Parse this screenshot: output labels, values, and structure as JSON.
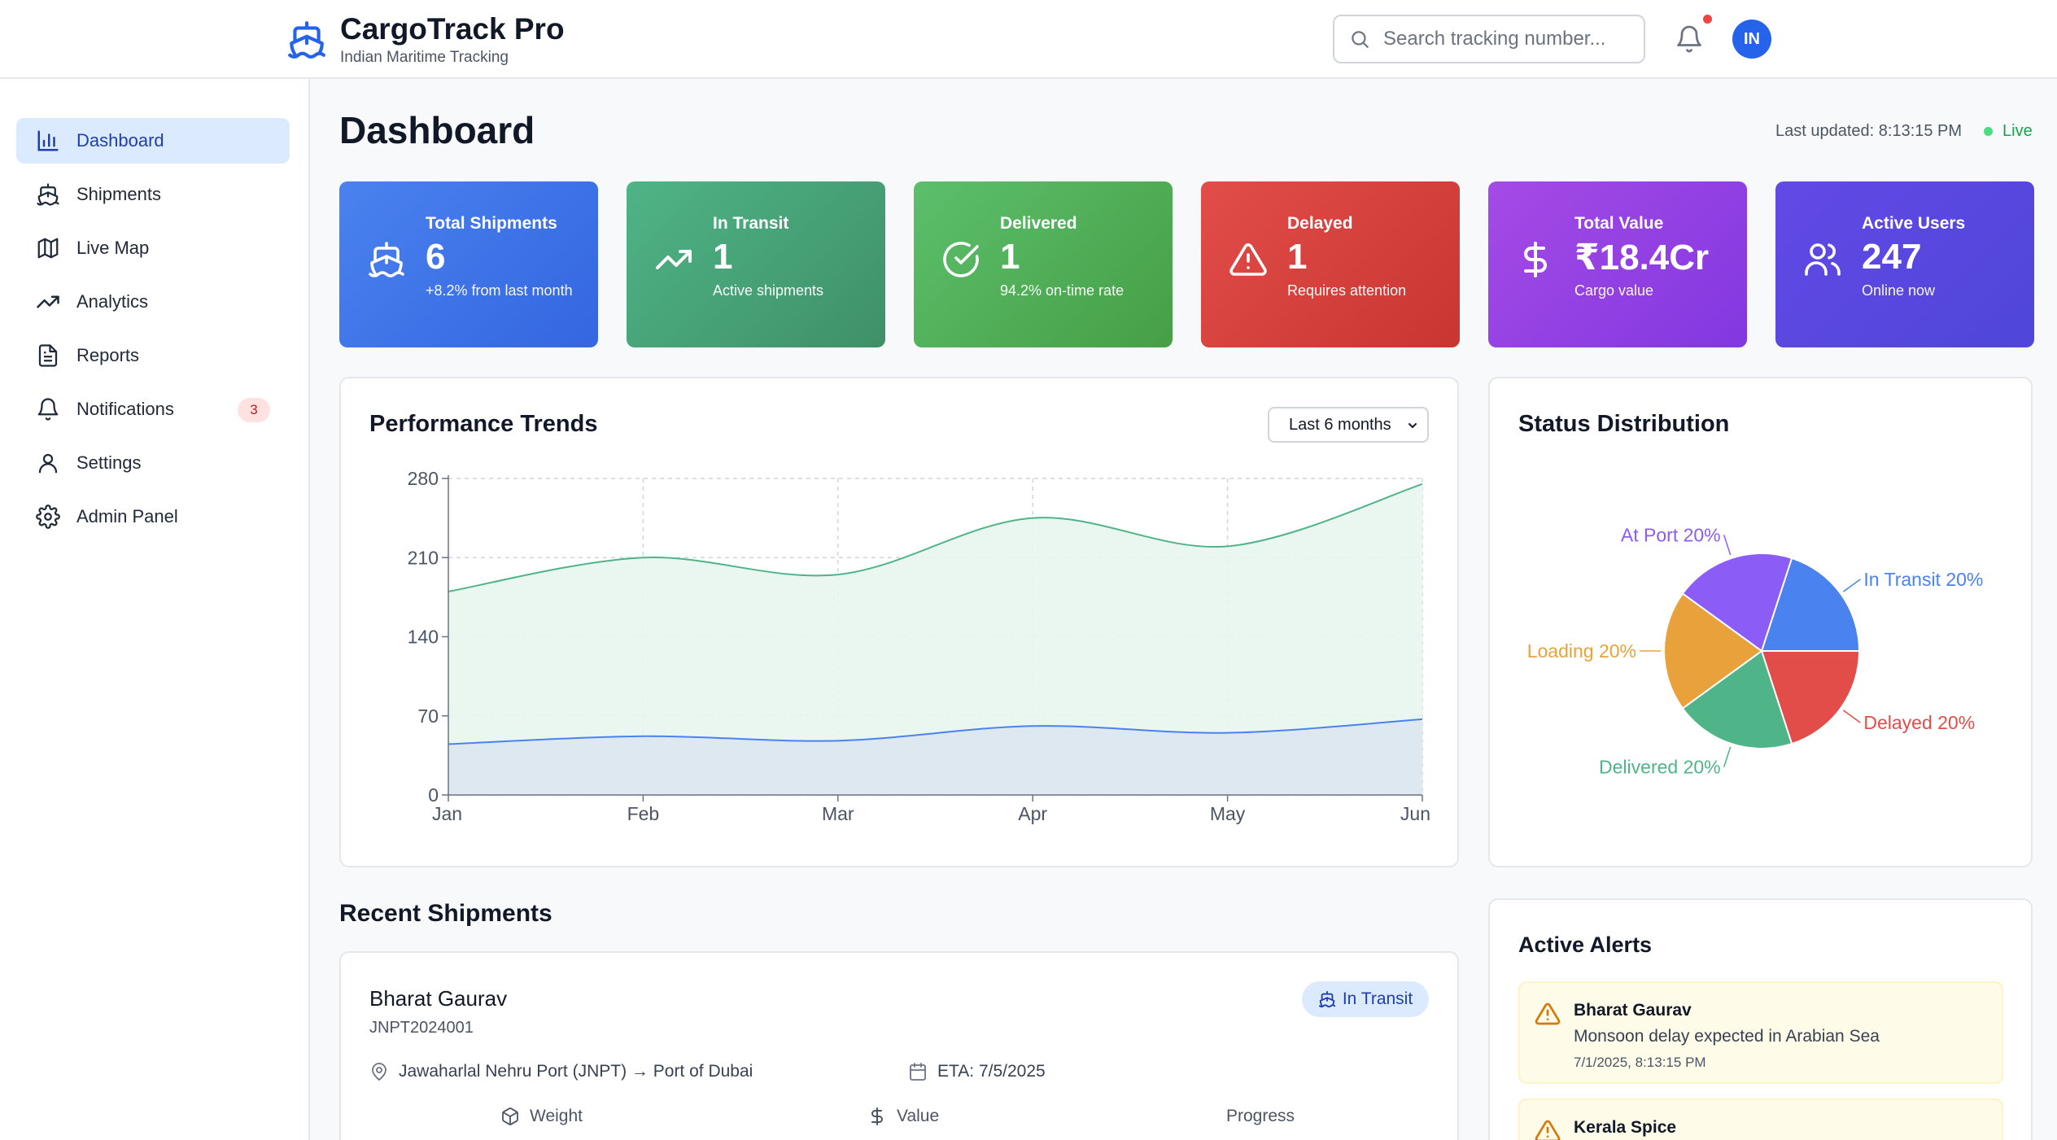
{
  "brand": {
    "title": "CargoTrack Pro",
    "subtitle": "Indian Maritime Tracking"
  },
  "search": {
    "placeholder": "Search tracking number..."
  },
  "user": {
    "initials": "IN"
  },
  "sidebar": {
    "items": [
      {
        "label": "Dashboard",
        "icon": "bar-chart-icon",
        "active": true
      },
      {
        "label": "Shipments",
        "icon": "ship-icon"
      },
      {
        "label": "Live Map",
        "icon": "map-icon"
      },
      {
        "label": "Analytics",
        "icon": "trending-up-icon"
      },
      {
        "label": "Reports",
        "icon": "file-text-icon"
      },
      {
        "label": "Notifications",
        "icon": "bell-icon",
        "badge": "3"
      },
      {
        "label": "Settings",
        "icon": "user-icon"
      },
      {
        "label": "Admin Panel",
        "icon": "gear-icon"
      }
    ]
  },
  "header": {
    "title": "Dashboard",
    "last_updated": "Last updated: 8:13:15 PM",
    "live": "Live"
  },
  "stats": [
    {
      "label": "Total Shipments",
      "value": "6",
      "sub": "+8.2% from last month",
      "icon": "ship-icon",
      "color_from": "#4a82ef",
      "color_to": "#3466e0"
    },
    {
      "label": "In Transit",
      "value": "1",
      "sub": "Active shipments",
      "icon": "trending-up-icon",
      "color_from": "#4fb487",
      "color_to": "#3f9068"
    },
    {
      "label": "Delivered",
      "value": "1",
      "sub": "94.2% on-time rate",
      "icon": "check-circle-icon",
      "color_from": "#5cbf6c",
      "color_to": "#469f45"
    },
    {
      "label": "Delayed",
      "value": "1",
      "sub": "Requires attention",
      "icon": "alert-triangle-icon",
      "color_from": "#e24d4a",
      "color_to": "#c93530"
    },
    {
      "label": "Total Value",
      "value": "₹18.4Cr",
      "sub": "Cargo value",
      "icon": "dollar-icon",
      "color_from": "#a54ae6",
      "color_to": "#8238e0"
    },
    {
      "label": "Active Users",
      "value": "247",
      "sub": "Online now",
      "icon": "users-icon",
      "color_from": "#6249e6",
      "color_to": "#4f46d8"
    }
  ],
  "performance": {
    "title": "Performance Trends",
    "range_select": "Last 6 months"
  },
  "status": {
    "title": "Status Distribution"
  },
  "chart_data": [
    {
      "type": "area",
      "title": "Performance Trends",
      "categories": [
        "Jan",
        "Feb",
        "Mar",
        "Apr",
        "May",
        "Jun"
      ],
      "ylim": [
        0,
        280
      ],
      "yticks": [
        0,
        70,
        140,
        210,
        280
      ],
      "grid": true,
      "series": [
        {
          "values": [
            180,
            210,
            195,
            245,
            220,
            275
          ],
          "color": "#4fb487",
          "fill": "#e8f5ee"
        },
        {
          "values": [
            45,
            52,
            48,
            61,
            55,
            67
          ],
          "color": "#4a82ef",
          "fill": "#dbe7f1"
        }
      ]
    },
    {
      "type": "pie",
      "title": "Status Distribution",
      "slices": [
        {
          "label": "In Transit 20%",
          "value": 20,
          "color": "#4a82ef"
        },
        {
          "label": "Delayed 20%",
          "value": 20,
          "color": "#e24d4a"
        },
        {
          "label": "Delivered 20%",
          "value": 20,
          "color": "#4fb487"
        },
        {
          "label": "Loading 20%",
          "value": 20,
          "color": "#e9a23b"
        },
        {
          "label": "At Port 20%",
          "value": 20,
          "color": "#8b5cf6"
        }
      ]
    }
  ],
  "recent": {
    "title": "Recent Shipments",
    "shipment": {
      "name": "Bharat Gaurav",
      "id": "JNPT2024001",
      "status": "In Transit",
      "route": "Jawaharlal Nehru Port (JNPT) → Port of Dubai",
      "eta": "ETA: 7/5/2025",
      "col_weight": "Weight",
      "col_value": "Value",
      "col_progress": "Progress"
    }
  },
  "alerts": {
    "title": "Active Alerts",
    "items": [
      {
        "title": "Bharat Gaurav",
        "message": "Monsoon delay expected in Arabian Sea",
        "time": "7/1/2025, 8:13:15 PM"
      },
      {
        "title": "Kerala Spice",
        "message": "",
        "time": ""
      }
    ]
  }
}
